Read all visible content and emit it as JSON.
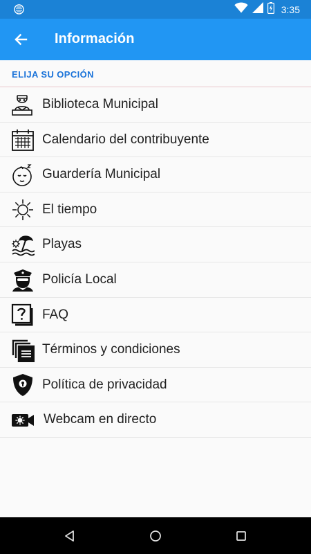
{
  "status_bar": {
    "time": "3:35",
    "icons": [
      "notification-circle-icon",
      "wifi-icon",
      "cellular-signal-icon",
      "battery-charging-icon"
    ]
  },
  "app_bar": {
    "title": "Información",
    "back_icon": "arrow-left-icon"
  },
  "section": {
    "header": "ELIJA SU OPCIÓN"
  },
  "menu": {
    "items": [
      {
        "label": "Biblioteca Municipal",
        "icon": "librarian-icon"
      },
      {
        "label": "Calendario del contribuyente",
        "icon": "calendar-icon"
      },
      {
        "label": "Guardería Municipal",
        "icon": "sleeping-baby-icon"
      },
      {
        "label": "El tiempo",
        "icon": "sun-icon"
      },
      {
        "label": "Playas",
        "icon": "beach-icon"
      },
      {
        "label": "Policía Local",
        "icon": "police-officer-icon"
      },
      {
        "label": "FAQ",
        "icon": "question-icon"
      },
      {
        "label": "Términos y condiciones",
        "icon": "document-stack-icon"
      },
      {
        "label": "Política de privacidad",
        "icon": "shield-lock-icon"
      },
      {
        "label": "Webcam en directo",
        "icon": "video-camera-icon"
      }
    ]
  },
  "nav_bar": {
    "buttons": [
      "back-triangle-icon",
      "home-circle-icon",
      "recents-square-icon"
    ]
  },
  "colors": {
    "status_bar": "#1b82d6",
    "app_bar": "#2196f3",
    "section_header_text": "#1a73d9",
    "nav_bar": "#000000"
  }
}
